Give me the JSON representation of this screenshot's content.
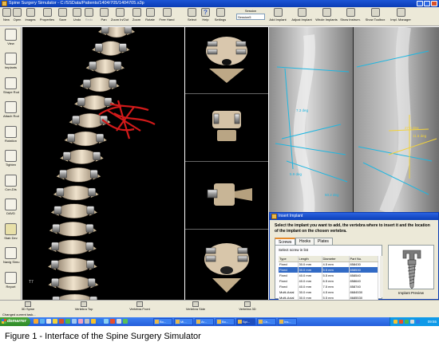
{
  "window": {
    "title": "Spine Surgery Simulator - C:/SSData/Patients/1404/705/1404705.s3p"
  },
  "toolbar": {
    "buttons": [
      {
        "label": "New",
        "icon": "new-file-icon"
      },
      {
        "label": "Open",
        "icon": "open-folder-icon"
      },
      {
        "label": "Images",
        "icon": "images-icon"
      },
      {
        "label": "Properties",
        "icon": "properties-icon"
      },
      {
        "label": "Save",
        "icon": "save-icon"
      },
      {
        "label": "Undo",
        "icon": "undo-icon"
      },
      {
        "label": "Redo",
        "icon": "redo-icon"
      },
      {
        "label": "Pan",
        "icon": "pan-icon"
      },
      {
        "label": "Zoom In/Out",
        "icon": "zoom-icon"
      },
      {
        "label": "Zoom",
        "icon": "zoom-window-icon"
      },
      {
        "label": "Rotate",
        "icon": "rotate-icon"
      },
      {
        "label": "Free Hand",
        "icon": "free-hand-icon"
      },
      {
        "label": "Select",
        "icon": "select-icon"
      },
      {
        "label": "Help",
        "icon": "help-icon"
      },
      {
        "label": "Settings",
        "icon": "settings-icon"
      }
    ],
    "session_label": "Session",
    "session_value": "Session5",
    "right_buttons": [
      {
        "label": "Add Implant",
        "icon": "add-implant-icon"
      },
      {
        "label": "Adjust Implant",
        "icon": "adjust-implant-icon"
      },
      {
        "label": "Whole Implants",
        "icon": "whole-implants-icon"
      },
      {
        "label": "Show Instrum.",
        "icon": "show-instruments-icon"
      },
      {
        "label": "Show Toolbox",
        "icon": "toolbox-icon"
      },
      {
        "label": "Impl. Manager",
        "icon": "implant-manager-icon"
      }
    ]
  },
  "sidebar": {
    "items": [
      {
        "label": "View",
        "icon": "view-icon"
      },
      {
        "label": "Implants",
        "icon": "implants-icon"
      },
      {
        "label": "Shape Rod",
        "icon": "shape-rod-icon"
      },
      {
        "label": "Attach Rod",
        "icon": "attach-rod-icon"
      },
      {
        "label": "Rotation",
        "icon": "rotation-icon"
      },
      {
        "label": "Tighten",
        "icon": "tighten-icon"
      },
      {
        "label": "Con-Dis",
        "icon": "con-dis-icon"
      },
      {
        "label": "DAVD",
        "icon": "davd-icon"
      },
      {
        "label": "Stab Dev",
        "icon": "stab-dev-icon"
      },
      {
        "label": "Navig Simu",
        "icon": "navig-simu-icon"
      },
      {
        "label": "Report",
        "icon": "report-icon"
      }
    ]
  },
  "view3d": {
    "vertebra_label": "T7"
  },
  "xray": {
    "measurements": [
      "7.3 deg",
      "5.9 deg",
      "50.2 deg",
      "27.0 deg",
      "11.5 deg"
    ],
    "accent_color": "#1fb6e0",
    "measure_color": "#f2d23a"
  },
  "dialog": {
    "title": "Insert Implant",
    "instruction": "Select the implant you want to add, the vertebra where to insert it and the location of the implant on the chosen vertebra.",
    "tabs": [
      "Screws",
      "Hooks",
      "Plates"
    ],
    "list_label": "Select screw in list",
    "columns": [
      "Type",
      "Length",
      "Diameter",
      "Part No."
    ],
    "rows": [
      [
        "Fixed",
        "30.0 mm",
        "4.5 mm",
        "858430"
      ],
      [
        "Fixed",
        "30.0 mm",
        "5.5 mm",
        "858530"
      ],
      [
        "Fixed",
        "40.0 mm",
        "5.5 mm",
        "858540"
      ],
      [
        "Fixed",
        "40.0 mm",
        "6.5 mm",
        "858640"
      ],
      [
        "Fixed",
        "40.0 mm",
        "7.5 mm",
        "858740"
      ],
      [
        "Multi-Axial",
        "30.0 mm",
        "4.5 mm",
        "8684530"
      ],
      [
        "Multi-Axial",
        "30.0 mm",
        "5.5 mm",
        "8685530"
      ]
    ],
    "selected_row": 1,
    "preview_label": "Implant Preview"
  },
  "viewbar": {
    "buttons": [
      {
        "label": "3D Spine",
        "icon": "spine-3d-icon"
      },
      {
        "label": "Vertebra Top",
        "icon": "vertebra-top-icon"
      },
      {
        "label": "Vertebra Front",
        "icon": "vertebra-front-icon"
      },
      {
        "label": "Vertebra Side",
        "icon": "vertebra-side-icon"
      },
      {
        "label": "Vertebra 3D",
        "icon": "vertebra-3d-icon"
      }
    ]
  },
  "status": {
    "text": "Changed current task..."
  },
  "taskbar": {
    "start_label": "demarrer",
    "tasks": [
      "Bo...",
      "Mi...",
      "Ar...",
      "Bo...",
      "Spi...",
      "Ch...",
      "Ins..."
    ],
    "active_task": 4,
    "clock": "09:55"
  },
  "caption": "Figure 1 - Interface of the Spine Surgery Simulator"
}
